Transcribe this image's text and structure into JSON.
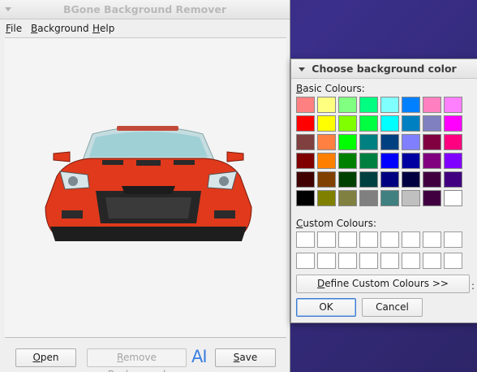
{
  "main_window": {
    "title": "BGone Background Remover",
    "menu": [
      {
        "key": "F",
        "rest": "ile"
      },
      {
        "key": "B",
        "rest": "ackground"
      },
      {
        "key": "H",
        "rest": "elp"
      }
    ],
    "buttons": {
      "open_key": "O",
      "open_rest": "pen",
      "remove_key": "R",
      "remove_rest": "emove Background",
      "save_key": "S",
      "save_rest": "ave"
    },
    "logo_text": "AI"
  },
  "dialog": {
    "title": "Choose background color",
    "basic_label_key": "B",
    "basic_label_rest": "asic Colours:",
    "custom_label_key": "C",
    "custom_label_rest": "ustom Colours:",
    "define_key": "D",
    "define_rest": "efine Custom Colours >>",
    "ok_label": "OK",
    "cancel_label": "Cancel",
    "basic_colors": [
      "#ff8080",
      "#ffff80",
      "#80ff80",
      "#00ff80",
      "#80ffff",
      "#0080ff",
      "#ff80c0",
      "#ff80ff",
      "#ff0000",
      "#ffff00",
      "#80ff00",
      "#00ff40",
      "#00ffff",
      "#0080c0",
      "#8080c0",
      "#ff00ff",
      "#804040",
      "#ff8040",
      "#00ff00",
      "#008080",
      "#004080",
      "#8080ff",
      "#800040",
      "#ff0080",
      "#800000",
      "#ff8000",
      "#008000",
      "#008040",
      "#0000ff",
      "#0000a0",
      "#800080",
      "#8000ff",
      "#400000",
      "#804000",
      "#004000",
      "#004040",
      "#000080",
      "#000040",
      "#400040",
      "#400080",
      "#000000",
      "#808000",
      "#808040",
      "#808080",
      "#408080",
      "#c0c0c0",
      "#400040",
      "#ffffff"
    ],
    "custom_colors": [
      "#ffffff",
      "#ffffff",
      "#ffffff",
      "#ffffff",
      "#ffffff",
      "#ffffff",
      "#ffffff",
      "#ffffff",
      "#ffffff",
      "#ffffff",
      "#ffffff",
      "#ffffff",
      "#ffffff",
      "#ffffff",
      "#ffffff",
      "#ffffff"
    ],
    "right_edge_glyph": ":"
  },
  "colors": {
    "desktop": "#3a2f8a",
    "car_body": "#e0391c",
    "accent": "#3a7fe0"
  }
}
